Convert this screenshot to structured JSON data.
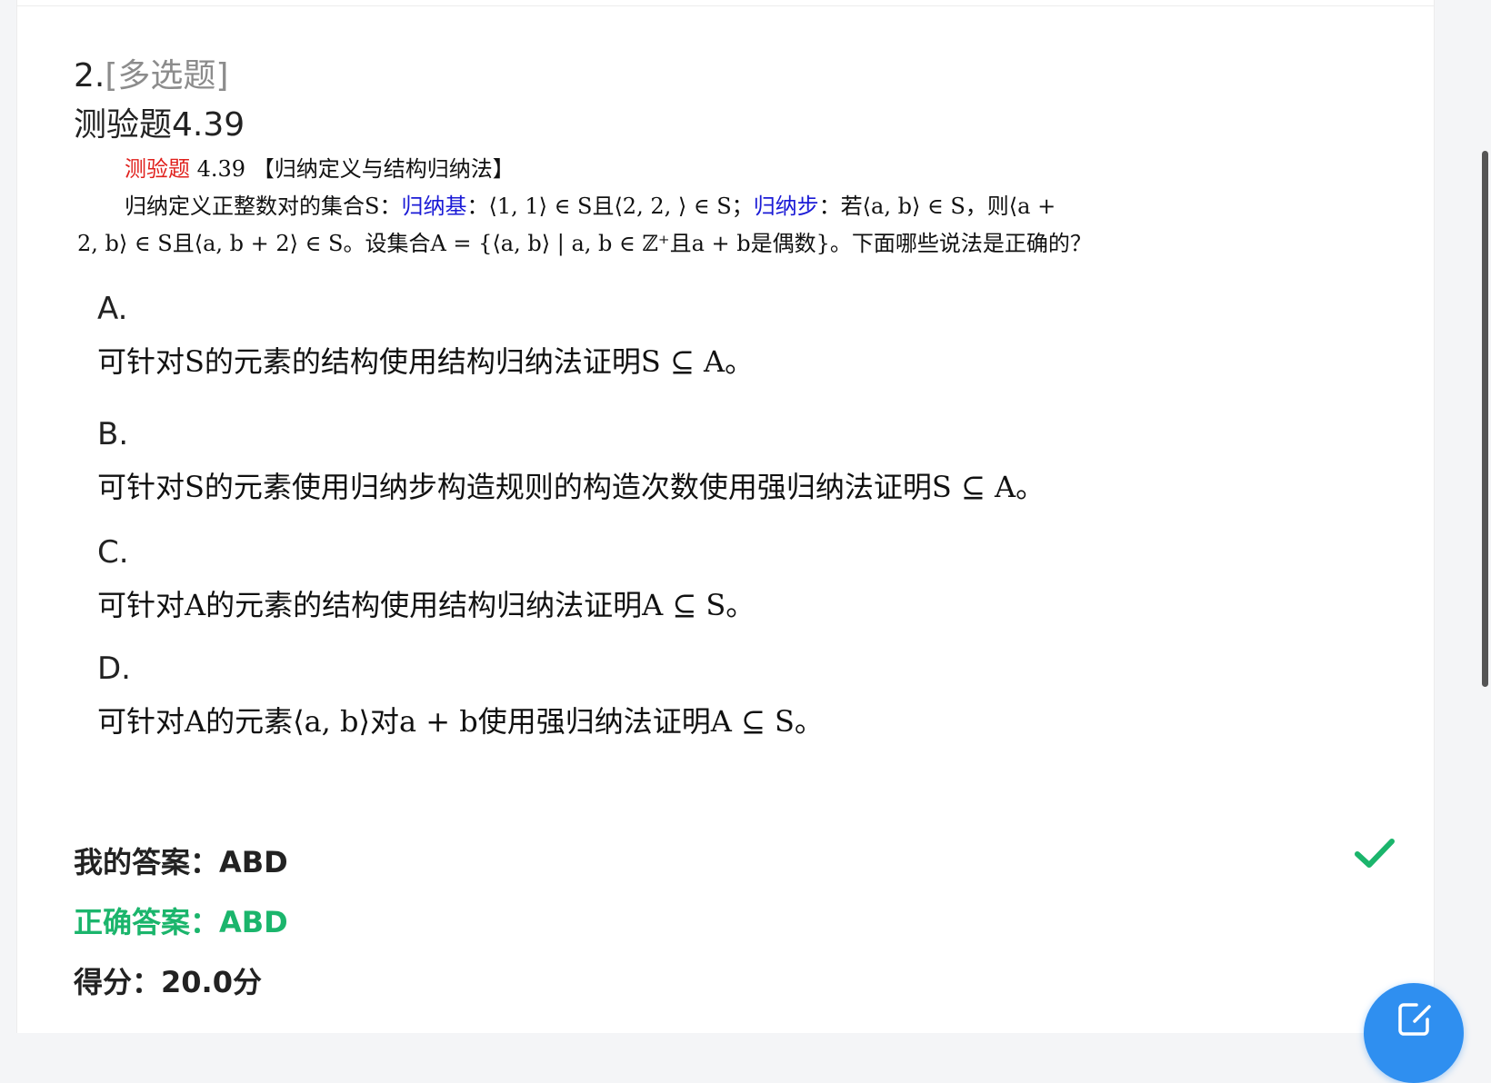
{
  "question": {
    "number": "2.",
    "type": "[多选题]",
    "title": "测验题4.39",
    "stem": {
      "label": "测验题",
      "number": "4.39",
      "section": "【归纳定义与结构归纳法】",
      "intro": "归纳定义正整数对的集合S：",
      "base_label": "归纳基",
      "base_text": "：⟨1, 1⟩ ∈ S且⟨2, 2, ⟩ ∈ S；",
      "step_label": "归纳步",
      "step_text": "：若⟨a, b⟩ ∈ S，则⟨a +",
      "line2": "2, b⟩ ∈ S且⟨a, b + 2⟩ ∈ S。设集合A = {⟨a, b⟩ | a, b ∈ ℤ⁺且a + b是偶数}。下面哪些说法是正确的？"
    }
  },
  "options": [
    {
      "letter": "A.",
      "text": "可针对S的元素的结构使用结构归纳法证明S ⊆ A。"
    },
    {
      "letter": "B.",
      "text": "可针对S的元素使用归纳步构造规则的构造次数使用强归纳法证明S ⊆ A。"
    },
    {
      "letter": "C.",
      "text": "可针对A的元素的结构使用结构归纳法证明A ⊆ S。"
    },
    {
      "letter": "D.",
      "text": "可针对A的元素⟨a, b⟩对a + b使用强归纳法证明A ⊆ S。"
    }
  ],
  "result": {
    "my_answer": "我的答案：ABD",
    "correct_answer": "正确答案：ABD",
    "score": "得分：20.0分"
  },
  "colors": {
    "correct_green": "#1bb56c",
    "fab_blue": "#2f8ff0",
    "stem_red": "#e0201c",
    "stem_blue": "#1a1ad6"
  },
  "icons": {
    "check": "check-icon",
    "fab": "edit-icon"
  }
}
